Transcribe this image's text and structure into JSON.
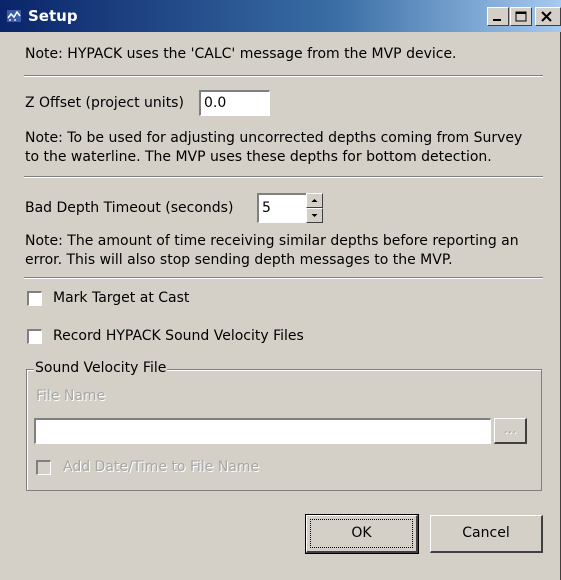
{
  "window": {
    "title": "Setup"
  },
  "notes": {
    "calc": "Note: HYPACK uses the 'CALC' message from the MVP device.",
    "z_offset_line1": "Note: To be used for adjusting uncorrected depths coming from Survey",
    "z_offset_line2": "to the waterline. The MVP uses these depths for bottom detection.",
    "timeout_line1": "Note: The amount of time receiving similar depths before reporting an",
    "timeout_line2": "error. This will also stop sending depth messages to the MVP."
  },
  "z_offset": {
    "label": "Z Offset (project units)",
    "value": "0.0"
  },
  "bad_depth_timeout": {
    "label": "Bad Depth Timeout (seconds)",
    "value": "5"
  },
  "options": {
    "mark_target_label": "Mark Target at Cast",
    "mark_target_checked": false,
    "record_sv_label": "Record HYPACK Sound Velocity Files",
    "record_sv_checked": false
  },
  "sound_velocity": {
    "group_label": "Sound Velocity File",
    "file_name_label": "File Name",
    "file_name_value": "",
    "browse_label": "...",
    "add_date_label": "Add Date/Time to File Name",
    "add_date_checked": false
  },
  "buttons": {
    "ok": "OK",
    "cancel": "Cancel"
  }
}
